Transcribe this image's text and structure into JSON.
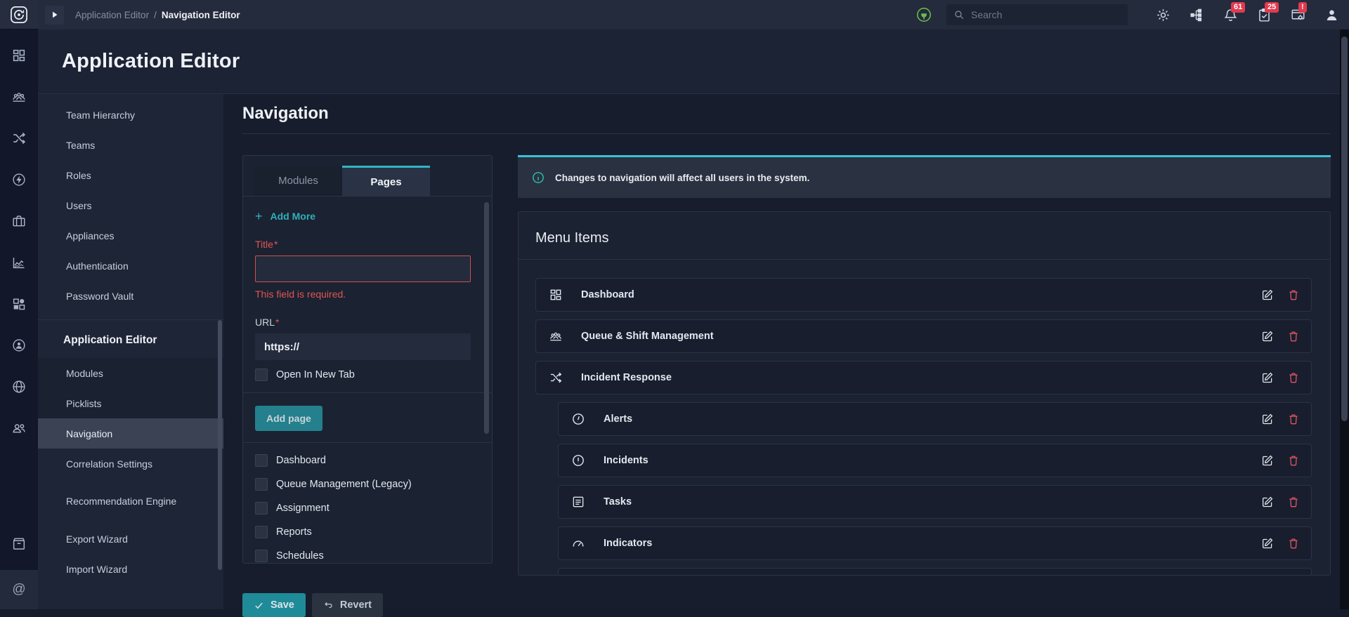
{
  "topbar": {
    "breadcrumb": {
      "parent": "Application Editor",
      "separator": "/",
      "current": "Navigation Editor"
    },
    "search_placeholder": "Search",
    "badges": {
      "notifications_count": "61",
      "approvals_count": "25",
      "system_alert": "!"
    }
  },
  "header": {
    "title": "Application Editor"
  },
  "icons": {
    "at_glyph": "@",
    "plus_glyph": "+"
  },
  "sidebar": {
    "items": [
      {
        "label": "Team Hierarchy"
      },
      {
        "label": "Teams"
      },
      {
        "label": "Roles"
      },
      {
        "label": "Users"
      },
      {
        "label": "Appliances"
      },
      {
        "label": "Authentication"
      },
      {
        "label": "Password Vault"
      }
    ],
    "section": {
      "title": "Application Editor",
      "items": [
        {
          "label": "Modules"
        },
        {
          "label": "Picklists"
        },
        {
          "label": "Navigation"
        },
        {
          "label": "Correlation Settings"
        },
        {
          "label": "Recommendation Engine"
        },
        {
          "label": "Export Wizard"
        },
        {
          "label": "Import Wizard"
        }
      ],
      "selected": "Navigation"
    }
  },
  "main": {
    "title": "Navigation",
    "editor_card": {
      "tabs": [
        {
          "label": "Modules"
        },
        {
          "label": "Pages"
        }
      ],
      "active_tab": "Pages",
      "add_more_label": "Add More",
      "title_field": {
        "label": "Title",
        "required_mark": "*",
        "value": "",
        "error": "This field is required."
      },
      "url_field": {
        "label": "URL",
        "required_mark": "*",
        "value": "https://"
      },
      "open_new_tab_label": "Open In New Tab",
      "add_page_label": "Add page",
      "pages": [
        {
          "label": "Dashboard"
        },
        {
          "label": "Queue Management (Legacy)"
        },
        {
          "label": "Assignment"
        },
        {
          "label": "Reports"
        },
        {
          "label": "Schedules"
        }
      ]
    },
    "banner": {
      "text": "Changes to navigation will affect all users in the system."
    },
    "menu": {
      "title": "Menu Items",
      "items": [
        {
          "label": "Dashboard",
          "icon": "dashboard-icon"
        },
        {
          "label": "Queue & Shift Management",
          "icon": "queue-icon"
        },
        {
          "label": "Incident Response",
          "icon": "shuffle-icon"
        },
        {
          "label": "Alerts",
          "icon": "alert-circle-icon"
        },
        {
          "label": "Incidents",
          "icon": "incident-circle-icon"
        },
        {
          "label": "Tasks",
          "icon": "tasks-icon"
        },
        {
          "label": "Indicators",
          "icon": "gauge-icon"
        }
      ]
    },
    "footer": {
      "save": "Save",
      "revert": "Revert"
    }
  },
  "colors": {
    "accent_teal": "#2fb5c4",
    "error_red": "#e25555",
    "badge_red": "#e23a4e",
    "success_green": "#6cc04a"
  }
}
